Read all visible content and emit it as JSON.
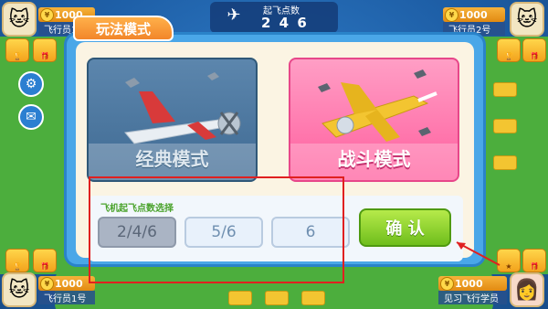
{
  "dialog": {
    "title": "玩法模式",
    "modes": [
      {
        "label": "经典模式"
      },
      {
        "label": "战斗模式"
      }
    ],
    "takeoff_section_label": "飞机起飞点数选择",
    "takeoff_options": [
      {
        "label": "2/4/6",
        "selected": true
      },
      {
        "label": "5/6",
        "selected": false
      },
      {
        "label": "6",
        "selected": false
      }
    ],
    "confirm_label": "确 认"
  },
  "hud": {
    "takeoff_points_label": "起飞点数",
    "takeoff_points_value": "2 4 6",
    "players": [
      {
        "coins": "1000",
        "name": "飞行员1号"
      },
      {
        "coins": "1000",
        "name": "飞行员2号"
      },
      {
        "coins": "1000",
        "name": "飞行员1号"
      },
      {
        "coins": "1000",
        "name": "见习飞行学员"
      }
    ]
  },
  "colors": {
    "accent_orange": "#f2862a",
    "dialog_blue": "#4aa7e8",
    "confirm_green": "#6fbe1c",
    "highlight_red": "#e02020"
  }
}
